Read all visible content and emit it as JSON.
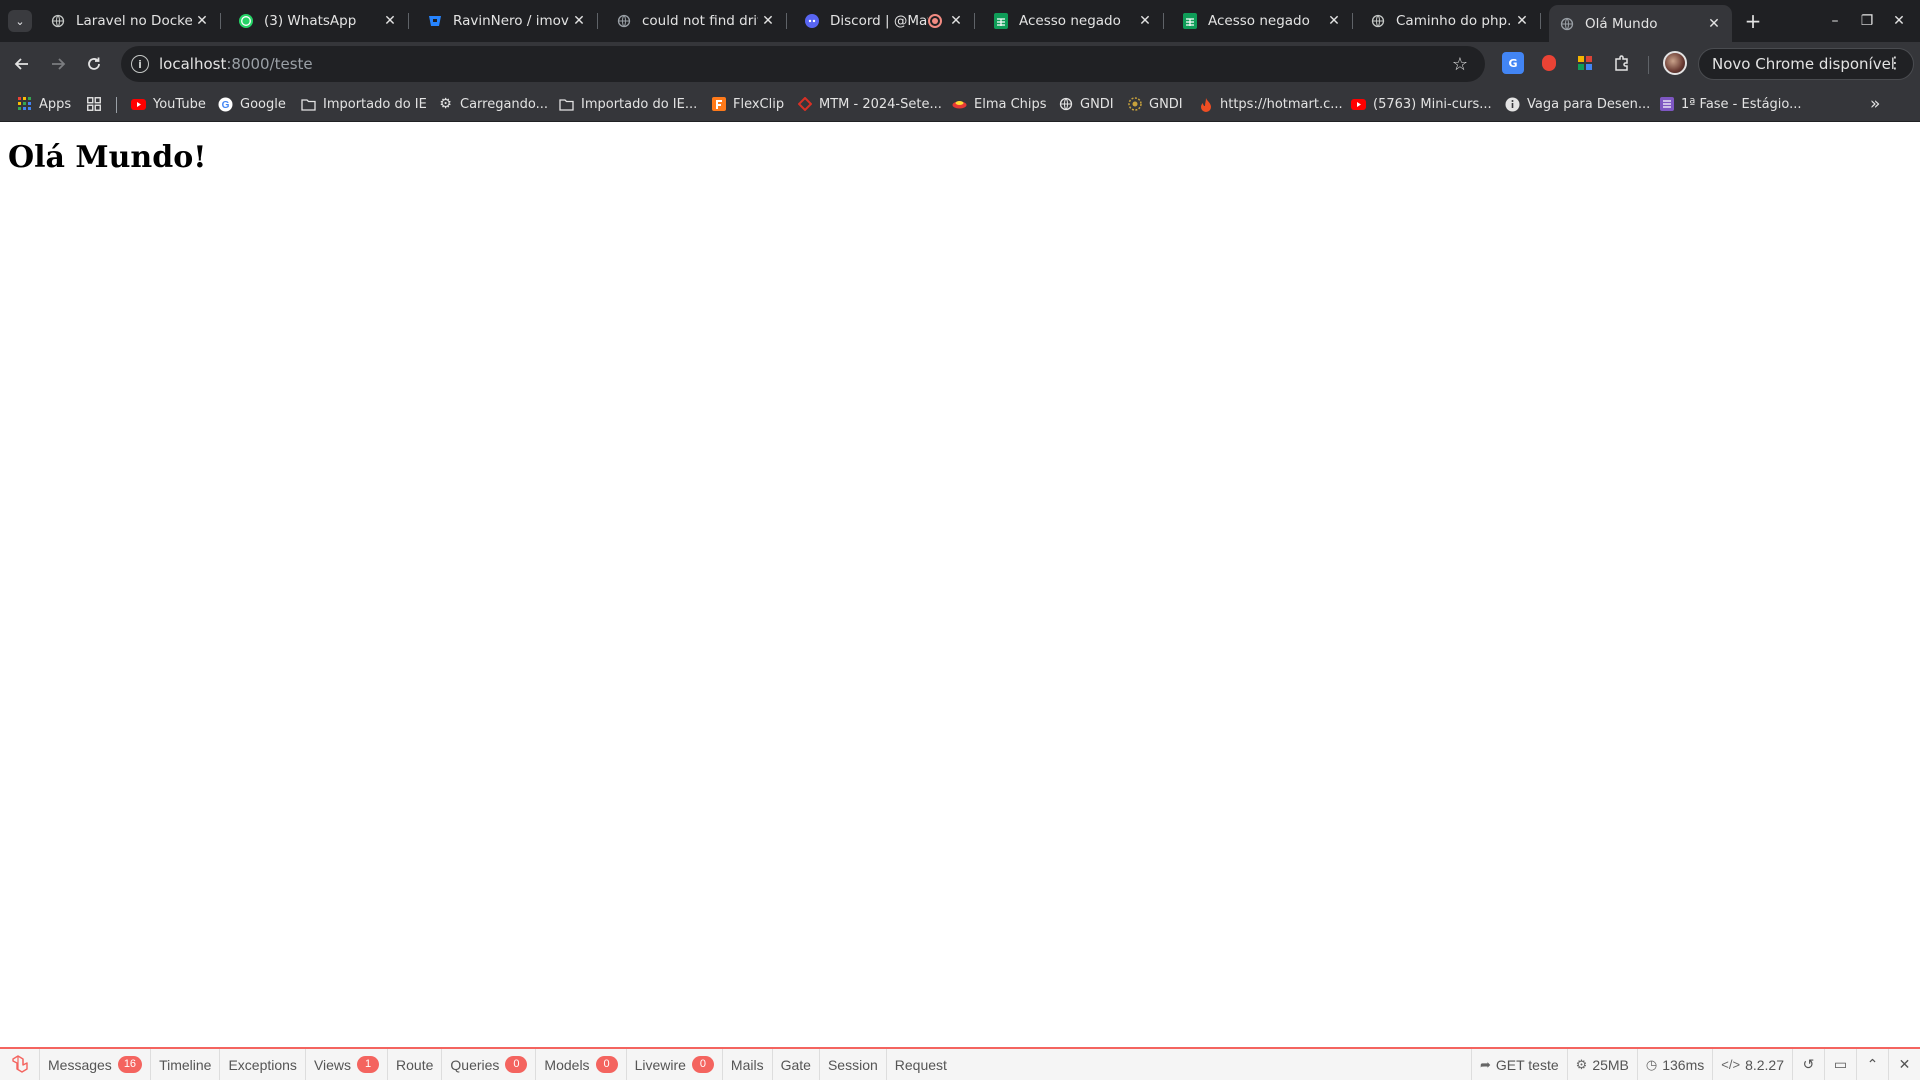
{
  "browser": {
    "tabs": [
      {
        "title": "Laravel no Docker T",
        "favicon": "globe-icon",
        "color": "#9aa0a6"
      },
      {
        "title": "(3) WhatsApp",
        "favicon": "whatsapp-icon",
        "color": "#25d366"
      },
      {
        "title": "RavinNero / imovelp",
        "favicon": "bitbucket-icon",
        "color": "#2684ff"
      },
      {
        "title": "could not find drive",
        "favicon": "globe-icon",
        "color": "#9aa0a6"
      },
      {
        "title": "Discord | @Math",
        "favicon": "discord-icon",
        "color": "#5865f2"
      },
      {
        "title": "Acesso negado",
        "favicon": "sheets-icon",
        "color": "#0f9d58"
      },
      {
        "title": "Acesso negado",
        "favicon": "sheets-icon",
        "color": "#0f9d58"
      },
      {
        "title": "Caminho do php.ex",
        "favicon": "globe-icon",
        "color": "#9aa0a6"
      },
      {
        "title": "Olá Mundo",
        "favicon": "globe-icon",
        "color": "#9aa0a6"
      }
    ],
    "tab_close": "✕",
    "new_tab": "+",
    "window_controls": {
      "minimize": "–",
      "restore": "❐",
      "close": "✕"
    },
    "address": {
      "host": "localhost",
      "path": ":8000/teste"
    },
    "update_button": "Novo Chrome disponível",
    "bookmarks": [
      {
        "label": "Apps",
        "icon": "apps-grid-icon"
      },
      {
        "label": "",
        "icon": "tab-groups-icon"
      },
      {
        "label": "YouTube",
        "icon": "youtube-icon"
      },
      {
        "label": "Google",
        "icon": "google-icon"
      },
      {
        "label": "Importado do IE",
        "icon": "folder-icon"
      },
      {
        "label": "Carregando...",
        "icon": "gear-icon"
      },
      {
        "label": "Importado do IE...",
        "icon": "folder-icon"
      },
      {
        "label": "FlexClip",
        "icon": "flexclip-icon"
      },
      {
        "label": "MTM - 2024-Sete...",
        "icon": "mtm-icon"
      },
      {
        "label": "Elma Chips",
        "icon": "elma-icon"
      },
      {
        "label": "GNDI",
        "icon": "globe-icon"
      },
      {
        "label": "GNDI",
        "icon": "gndi-icon"
      },
      {
        "label": "https://hotmart.c...",
        "icon": "hotmart-icon"
      },
      {
        "label": "(5763) Mini-curs...",
        "icon": "youtube-icon"
      },
      {
        "label": "Vaga para Desen...",
        "icon": "info-icon"
      },
      {
        "label": "1ª Fase - Estágio...",
        "icon": "list-icon"
      }
    ]
  },
  "page": {
    "heading": "Olá Mundo!"
  },
  "debugbar": {
    "tabs": [
      {
        "label": "Messages",
        "badge": "16"
      },
      {
        "label": "Timeline",
        "badge": ""
      },
      {
        "label": "Exceptions",
        "badge": ""
      },
      {
        "label": "Views",
        "badge": "1"
      },
      {
        "label": "Route",
        "badge": ""
      },
      {
        "label": "Queries",
        "badge": "0"
      },
      {
        "label": "Models",
        "badge": "0"
      },
      {
        "label": "Livewire",
        "badge": "0"
      },
      {
        "label": "Mails",
        "badge": ""
      },
      {
        "label": "Gate",
        "badge": ""
      },
      {
        "label": "Session",
        "badge": ""
      },
      {
        "label": "Request",
        "badge": ""
      }
    ],
    "indicators": {
      "route": "GET teste",
      "memory": "25MB",
      "time": "136ms",
      "php_version": "8.2.27"
    },
    "accent_color": "#f4645f"
  }
}
